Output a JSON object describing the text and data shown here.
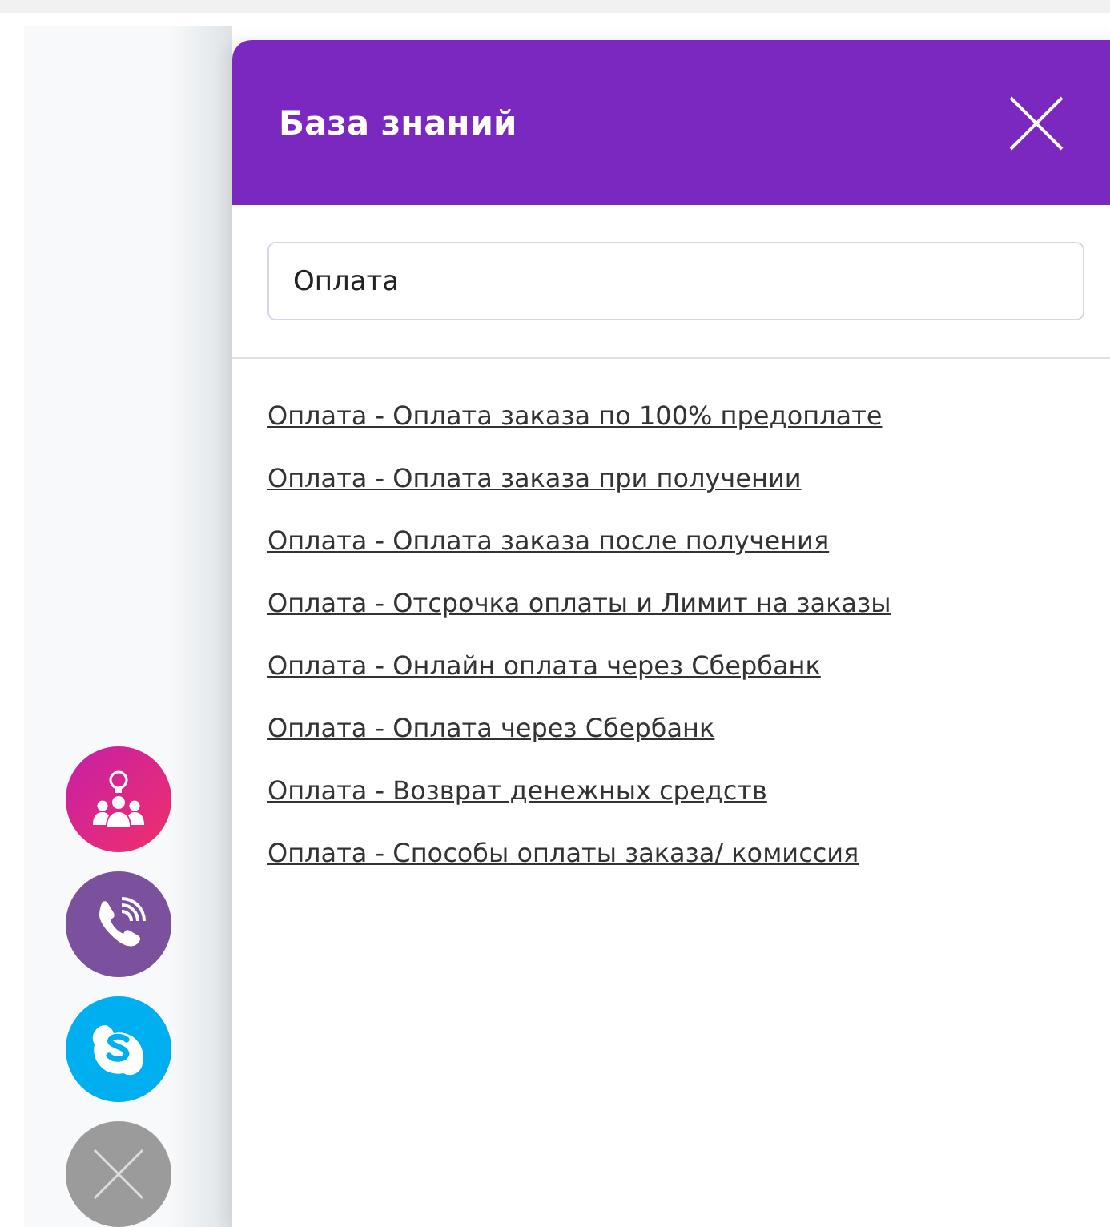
{
  "panel": {
    "title": "База знаний"
  },
  "search": {
    "value": "Оплата"
  },
  "results": [
    "Оплата - Оплата заказа по 100% предоплате",
    "Оплата - Оплата заказа при получении",
    "Оплата - Оплата заказа после получения",
    "Оплата - Отсрочка оплаты и Лимит на заказы",
    "Оплата - Онлайн оплата через Сбербанк",
    "Оплата - Оплата через Сбербанк",
    "Оплата - Возврат денежных средств",
    "Оплата - Способы оплаты заказа/ комиссия"
  ],
  "floating_buttons": [
    {
      "kind": "team"
    },
    {
      "kind": "phone"
    },
    {
      "kind": "skype"
    },
    {
      "kind": "close"
    }
  ]
}
